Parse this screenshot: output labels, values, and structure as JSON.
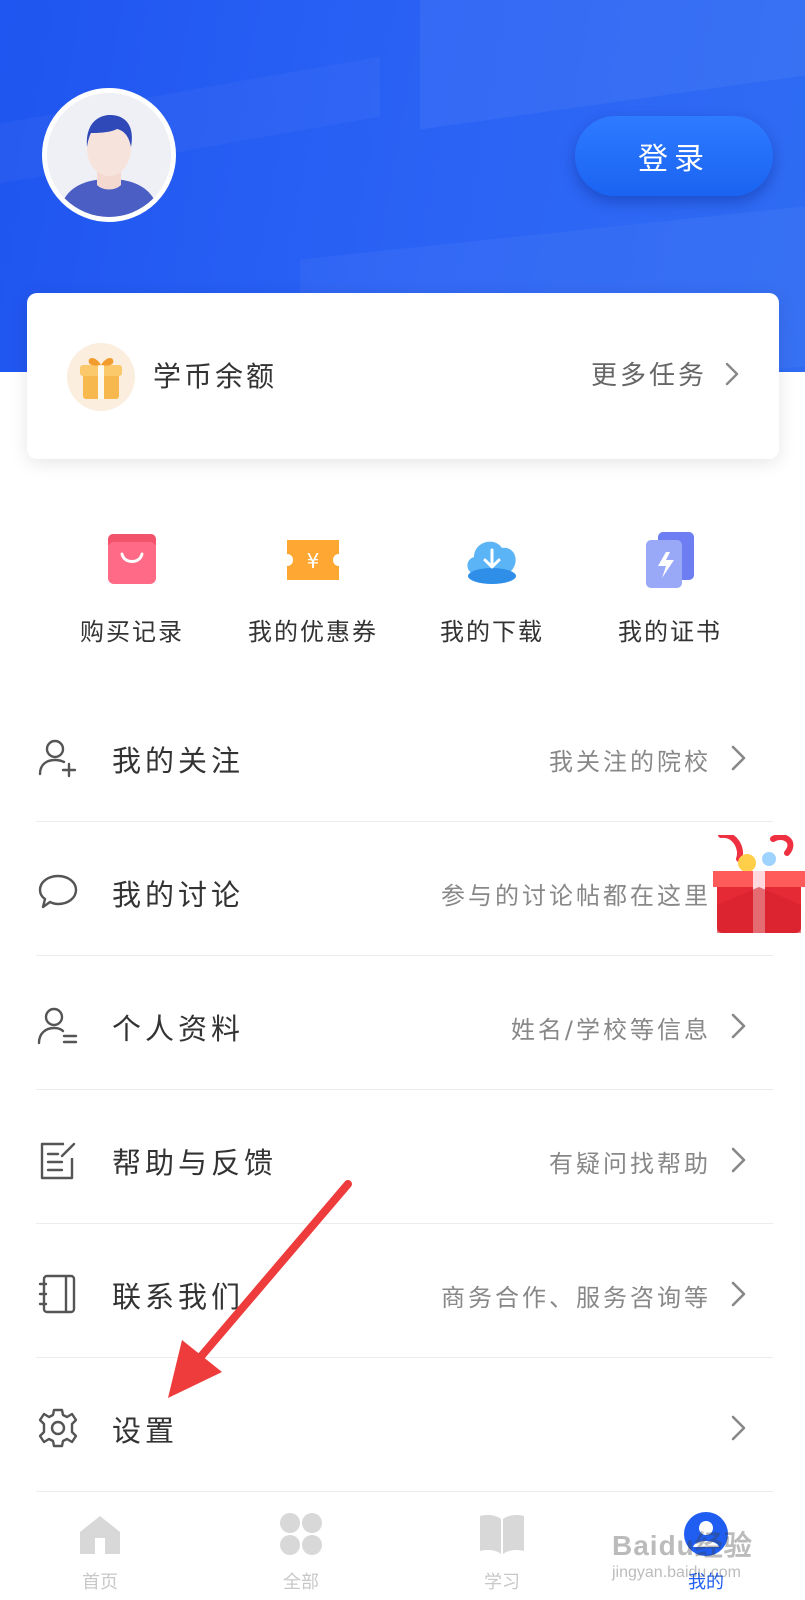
{
  "header": {
    "login_label": "登录"
  },
  "coin_card": {
    "label": "学币余额",
    "more_label": "更多任务"
  },
  "quick_actions": [
    {
      "label": "购买记录",
      "icon": "shopping-bag-icon"
    },
    {
      "label": "我的优惠券",
      "icon": "coupon-icon"
    },
    {
      "label": "我的下载",
      "icon": "cloud-download-icon"
    },
    {
      "label": "我的证书",
      "icon": "certificate-icon"
    }
  ],
  "menu": [
    {
      "label": "我的关注",
      "hint": "我关注的院校",
      "icon": "add-user-icon"
    },
    {
      "label": "我的讨论",
      "hint": "参与的讨论帖都在这里",
      "icon": "chat-bubble-icon"
    },
    {
      "label": "个人资料",
      "hint": "姓名/学校等信息",
      "icon": "user-profile-icon"
    },
    {
      "label": "帮助与反馈",
      "hint": "有疑问找帮助",
      "icon": "edit-note-icon"
    },
    {
      "label": "联系我们",
      "hint": "商务合作、服务咨询等",
      "icon": "contact-book-icon"
    },
    {
      "label": "设置",
      "hint": "",
      "icon": "gear-icon"
    }
  ],
  "tabbar": [
    {
      "label": "首页",
      "icon": "home-icon",
      "active": false
    },
    {
      "label": "全部",
      "icon": "grid-icon",
      "active": false
    },
    {
      "label": "学习",
      "icon": "book-icon",
      "active": false
    },
    {
      "label": "我的",
      "icon": "profile-icon",
      "active": true
    }
  ],
  "watermark": {
    "main": "Baidu经验",
    "sub": "jingyan.baidu.com"
  },
  "colors": {
    "brand_blue": "#1f5ef0",
    "annotation_red": "#ee3b3b"
  }
}
